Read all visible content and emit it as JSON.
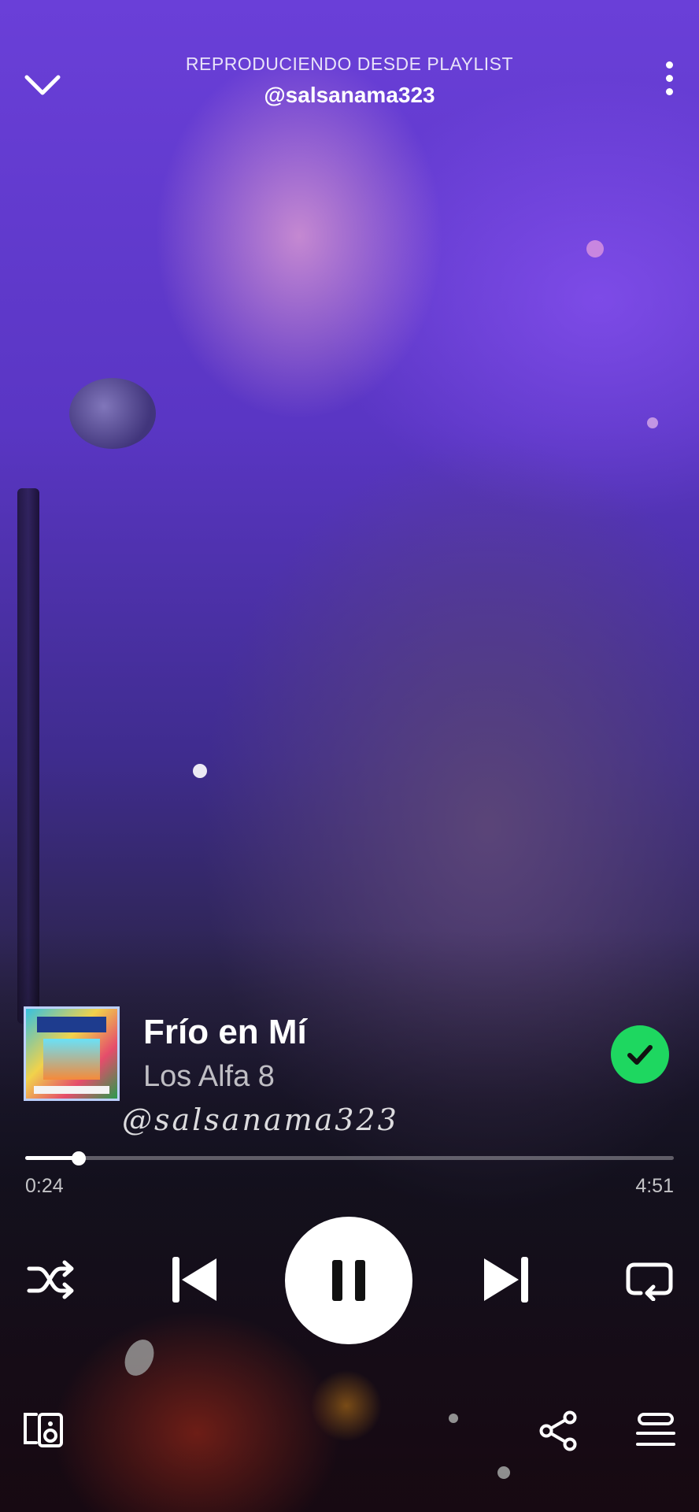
{
  "header": {
    "context_label": "REPRODUCIENDO DESDE PLAYLIST",
    "playlist_name": "@salsanama323"
  },
  "track": {
    "title": "Frío en Mí",
    "artist": "Los Alfa 8",
    "liked": true
  },
  "overlay": {
    "watermark": "@salsanama323"
  },
  "playback": {
    "elapsed": "0:24",
    "duration": "4:51",
    "progress_fraction": 0.0825,
    "is_playing": true
  },
  "icons": {
    "collapse": "chevron-down-icon",
    "more": "more-vertical-icon",
    "liked": "check-circle-icon",
    "shuffle": "shuffle-icon",
    "previous": "skip-previous-icon",
    "pause": "pause-icon",
    "next": "skip-next-icon",
    "repeat": "repeat-icon",
    "devices": "devices-icon",
    "share": "share-icon",
    "queue": "queue-icon"
  },
  "colors": {
    "accent": "#1ed760",
    "text": "#ffffff"
  }
}
